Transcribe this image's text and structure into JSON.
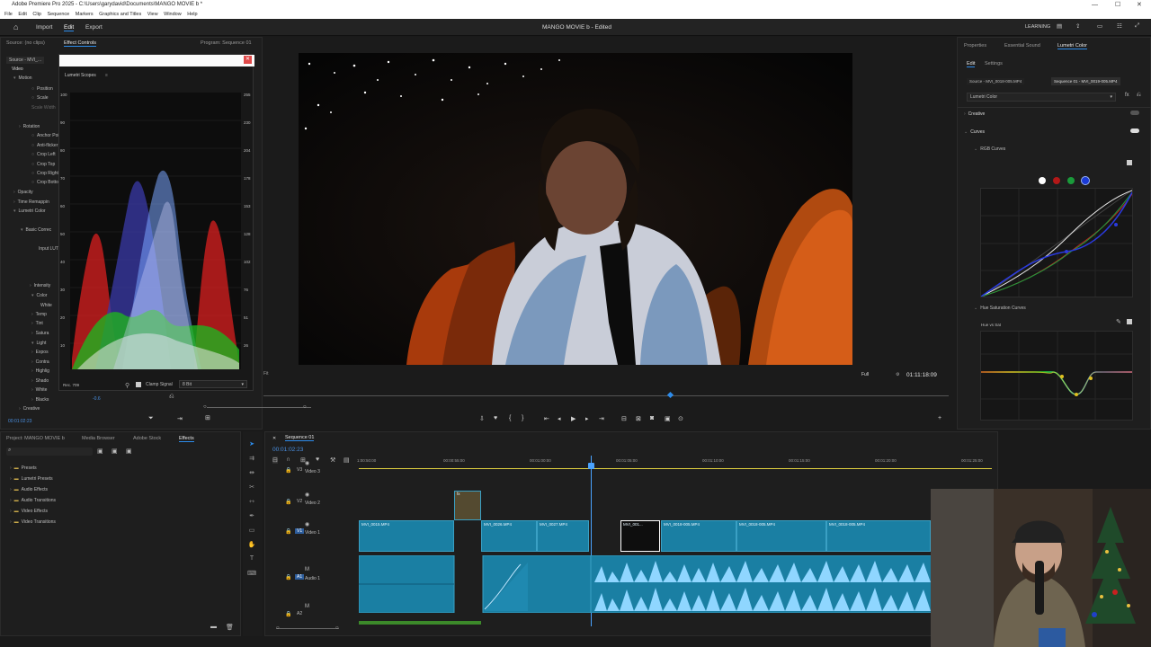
{
  "window": {
    "title": "Adobe Premiere Pro 2025 - C:\\Users\\garydavid\\Documents\\MANGO MOVIE b *"
  },
  "menu": [
    "File",
    "Edit",
    "Clip",
    "Sequence",
    "Markers",
    "Graphics and Titles",
    "View",
    "Window",
    "Help"
  ],
  "workspace": {
    "tabs": [
      "Import",
      "Edit",
      "Export"
    ],
    "active_tab": "Edit",
    "project_title": "MANGO MOVIE b - Edited",
    "learning_label": "LEARNING"
  },
  "effect_controls": {
    "tabs": [
      "Source: (no clips)",
      "Effect Controls",
      "Program: Sequence 01"
    ],
    "source_row": "Source - MVI_...",
    "video_header": "Video",
    "items": [
      "Motion",
      "Position",
      "Scale",
      "Scale Width",
      "Rotation",
      "Anchor Point",
      "Anti-flicker F",
      "Crop Left",
      "Crop Top",
      "Crop Right",
      "Crop Bottom",
      "Opacity",
      "Time Remappin",
      "Lumetri Color",
      "Basic Correc",
      "Input LUT",
      "Intensity",
      "Color",
      "White",
      "Temp",
      "Tint",
      "Satura",
      "Light",
      "Expos",
      "Contra",
      "Highlig",
      "Shado",
      "White",
      "Blacks",
      "Creative"
    ],
    "timecode": "00:01:02:23"
  },
  "scopes": {
    "title": "Lumetri Scopes",
    "right_scale": [
      "255",
      "230",
      "204",
      "178",
      "153",
      "128",
      "102",
      "76",
      "51",
      "26"
    ],
    "left_scale": [
      "100",
      "90",
      "80",
      "70",
      "60",
      "50",
      "40",
      "30",
      "20",
      "10"
    ],
    "colorspace": "Rec. 709",
    "clamp_label": "Clamp Signal",
    "bit_depth": "8 Bit",
    "left_value": "-0.6"
  },
  "program": {
    "fit": "Fit",
    "full": "Full",
    "timecode": "01:11:18:09"
  },
  "lumetri": {
    "tabs": [
      "Properties",
      "Essential Sound",
      "Lumetri Color"
    ],
    "subtabs": [
      "Edit",
      "Settings"
    ],
    "source_chip": "Source - MVI_0018-005.MP4",
    "sequence_chip": "Sequence 01 - MVI_0019-005.MP4",
    "effect_select": "Lumetri Color",
    "creative_label": "Creative",
    "curves_label": "Curves",
    "rgb_curves_label": "RGB Curves",
    "hue_sat_label": "Hue Saturation Curves",
    "hue_vs_sat_label": "Hue vs Sat"
  },
  "project_panel": {
    "tabs": [
      "Project: MANGO MOVIE b",
      "Media Browser",
      "Adobe Stock",
      "Effects"
    ],
    "active_tab": "Effects",
    "folders": [
      "Presets",
      "Lumetri Presets",
      "Audio Effects",
      "Audio Transitions",
      "Video Effects",
      "Video Transitions"
    ]
  },
  "timeline": {
    "tab": "Sequence 01",
    "timecode": "00:01:02:23",
    "ruler": [
      "1:00:50:00",
      "00:00:55:00",
      "00:01:00:00",
      "00:01:05:00",
      "00:01:10:00",
      "00:01:15:00",
      "00:01:20:00",
      "00:01:25:00"
    ],
    "tracks": {
      "v3": "V3",
      "v3_label": "Video 3",
      "v2": "V2",
      "v2_label": "Video 2",
      "v1": "V1",
      "v1_label": "Video 1",
      "a1": "A1",
      "a1_label": "Audio 1",
      "a2": "A2"
    },
    "clips": [
      "MVI_0015.MP4",
      "MVI_0026.MP4",
      "MVI_0027.MP4",
      "MVI_001...",
      "MVI_0018-005.MP4",
      "MVI_0018-005.MP4",
      "MVI_0018-005.MP4"
    ],
    "fx_label": "fx",
    "audio_level": "0"
  },
  "colors": {
    "accent": "#2d8ceb",
    "clip": "#1a7fa3",
    "playhead": "#4aa3ff"
  }
}
